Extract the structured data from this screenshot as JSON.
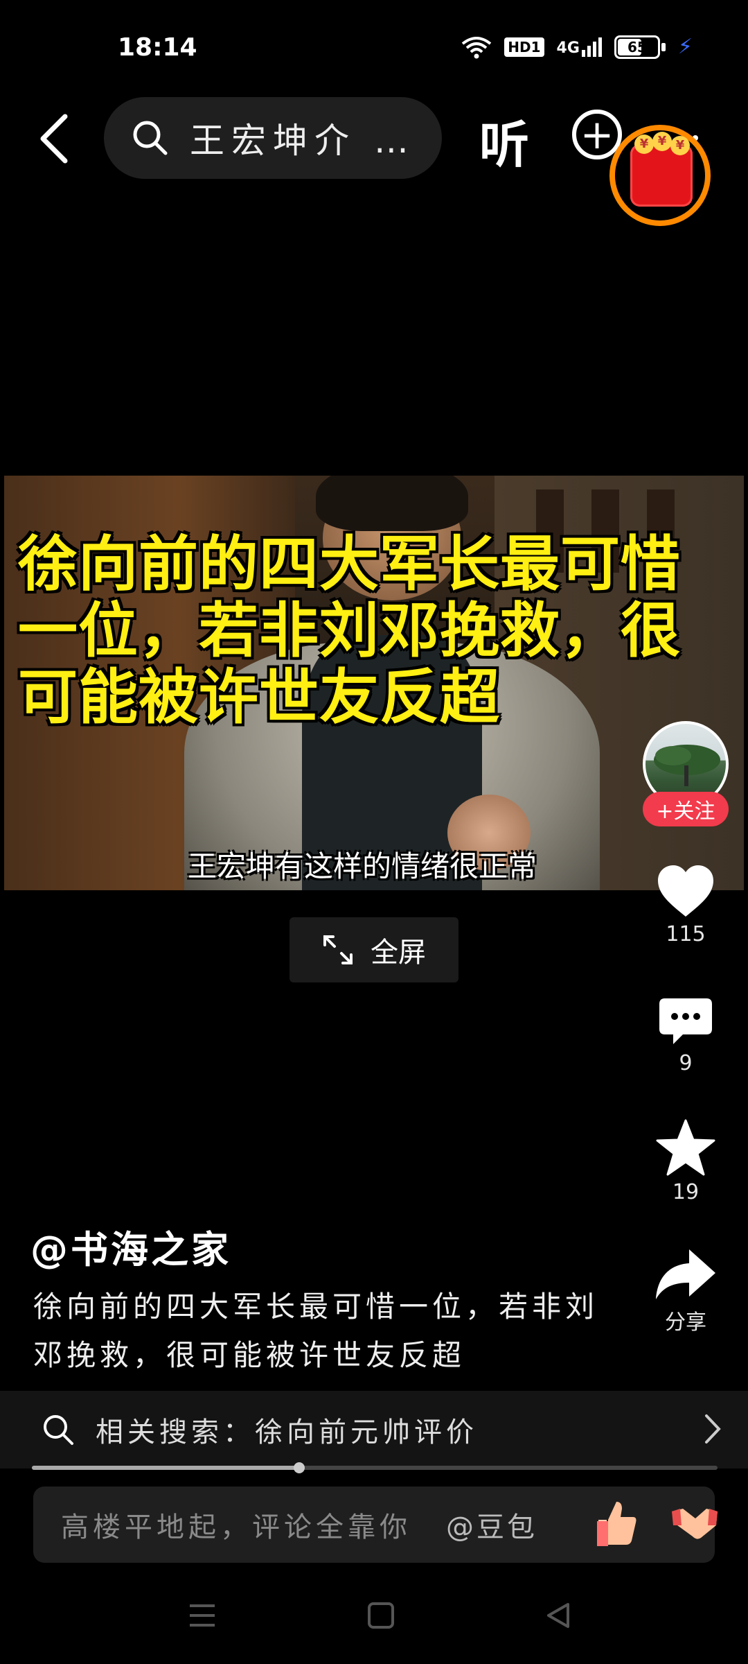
{
  "status_bar": {
    "time": "18:14",
    "hd_label": "HD1",
    "network_label": "4G",
    "battery_level": "65",
    "battery_fraction": 0.65,
    "icons": [
      "wifi-icon",
      "hd-icon",
      "signal-icon",
      "battery-icon",
      "charging-icon"
    ]
  },
  "top_bar": {
    "search_query": "王宏坤介 …",
    "listen_label": "听",
    "add_label": "+"
  },
  "video": {
    "title_overlay": "徐向前的四大军长最可惜一位，若非刘邓挽救，很可能被许世友反超",
    "subtitle": "王宏坤有这样的情绪很正常",
    "fullscreen_label": "全屏"
  },
  "rail": {
    "follow_label": "+关注",
    "like_count": "115",
    "comment_count": "9",
    "favorite_count": "19",
    "share_label": "分享"
  },
  "post": {
    "author": "@书海之家",
    "description": "徐向前的四大军长最可惜一位，若非刘邓挽救，很可能被许世友反超"
  },
  "related_search": {
    "label": "相关搜索：徐向前元帅评价"
  },
  "playback": {
    "progress_fraction": 0.39
  },
  "comment_input": {
    "placeholder": "高楼平地起，评论全靠你",
    "mention": "@豆包"
  },
  "colors": {
    "accent_red": "#f23b4c",
    "overlay_yellow": "#ffef12",
    "redpacket_ring": "#ff8a00"
  }
}
